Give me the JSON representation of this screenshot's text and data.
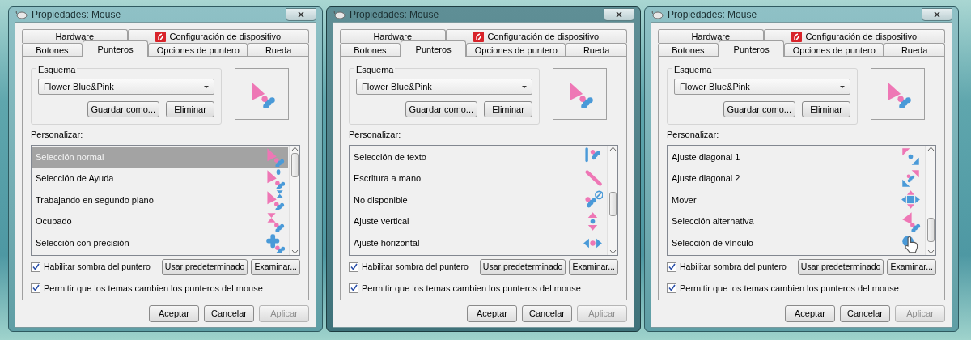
{
  "windows": [
    {
      "title": "Propiedades: Mouse",
      "active": false,
      "tabs_row1": [
        {
          "label": "Hardware",
          "selected": false
        },
        {
          "label": "Configuración de dispositivo",
          "selected": false
        }
      ],
      "tabs_row2": [
        {
          "label": "Botones",
          "selected": false
        },
        {
          "label": "Punteros",
          "selected": true
        },
        {
          "label": "Opciones de puntero",
          "selected": false
        },
        {
          "label": "Rueda",
          "selected": false
        }
      ],
      "scheme": {
        "legend": "Esquema",
        "value": "Flower Blue&Pink",
        "buttons": [
          "Guardar como...",
          "Eliminar"
        ]
      },
      "customize_label": "Personalizar:",
      "pointers": [
        {
          "label": "Selección normal",
          "kind": "normal",
          "selected": true
        },
        {
          "label": "Selección de Ayuda",
          "kind": "help",
          "selected": false
        },
        {
          "label": "Trabajando en segundo plano",
          "kind": "working",
          "selected": false
        },
        {
          "label": "Ocupado",
          "kind": "busy",
          "selected": false
        },
        {
          "label": "Selección con precisión",
          "kind": "precision",
          "selected": false
        }
      ],
      "checkboxes": [
        {
          "label": "Habilitar sombra del puntero",
          "checked": true
        },
        {
          "label": "Permitir que los temas cambien los punteros del mouse",
          "checked": true
        }
      ],
      "list_buttons": [
        "Usar predeterminado",
        "Examinar..."
      ],
      "footer_buttons": [
        {
          "label": "Aceptar",
          "disabled": false
        },
        {
          "label": "Cancelar",
          "disabled": false
        },
        {
          "label": "Aplicar",
          "disabled": true
        }
      ]
    },
    {
      "title": "Propiedades: Mouse",
      "active": true,
      "tabs_row1": [
        {
          "label": "Hardware",
          "selected": false
        },
        {
          "label": "Configuración de dispositivo",
          "selected": false
        }
      ],
      "tabs_row2": [
        {
          "label": "Botones",
          "selected": false
        },
        {
          "label": "Punteros",
          "selected": true
        },
        {
          "label": "Opciones de puntero",
          "selected": false
        },
        {
          "label": "Rueda",
          "selected": false
        }
      ],
      "scheme": {
        "legend": "Esquema",
        "value": "Flower Blue&Pink",
        "buttons": [
          "Guardar como...",
          "Eliminar"
        ]
      },
      "customize_label": "Personalizar:",
      "pointers": [
        {
          "label": "Selección de texto",
          "kind": "text",
          "selected": false
        },
        {
          "label": "Escritura a mano",
          "kind": "handwriting",
          "selected": false
        },
        {
          "label": "No disponible",
          "kind": "unavailable",
          "selected": false
        },
        {
          "label": "Ajuste vertical",
          "kind": "vertical",
          "selected": false
        },
        {
          "label": "Ajuste horizontal",
          "kind": "horizontal",
          "selected": false
        }
      ],
      "checkboxes": [
        {
          "label": "Habilitar sombra del puntero",
          "checked": true
        },
        {
          "label": "Permitir que los temas cambien los punteros del mouse",
          "checked": true
        }
      ],
      "list_buttons": [
        "Usar predeterminado",
        "Examinar..."
      ],
      "footer_buttons": [
        {
          "label": "Aceptar",
          "disabled": false
        },
        {
          "label": "Cancelar",
          "disabled": false
        },
        {
          "label": "Aplicar",
          "disabled": true
        }
      ]
    },
    {
      "title": "Propiedades: Mouse",
      "active": false,
      "tabs_row1": [
        {
          "label": "Hardware",
          "selected": false
        },
        {
          "label": "Configuración de dispositivo",
          "selected": false
        }
      ],
      "tabs_row2": [
        {
          "label": "Botones",
          "selected": false
        },
        {
          "label": "Punteros",
          "selected": true
        },
        {
          "label": "Opciones de puntero",
          "selected": false
        },
        {
          "label": "Rueda",
          "selected": false
        }
      ],
      "scheme": {
        "legend": "Esquema",
        "value": "Flower Blue&Pink",
        "buttons": [
          "Guardar como...",
          "Eliminar"
        ]
      },
      "customize_label": "Personalizar:",
      "pointers": [
        {
          "label": "Ajuste diagonal 1",
          "kind": "diag1",
          "selected": false
        },
        {
          "label": "Ajuste diagonal 2",
          "kind": "diag2",
          "selected": false
        },
        {
          "label": "Mover",
          "kind": "move",
          "selected": false
        },
        {
          "label": "Selección alternativa",
          "kind": "alternate",
          "selected": false
        },
        {
          "label": "Selección de vínculo",
          "kind": "link",
          "selected": false
        }
      ],
      "checkboxes": [
        {
          "label": "Habilitar sombra del puntero",
          "checked": true
        },
        {
          "label": "Permitir que los temas cambien los punteros del mouse",
          "checked": true
        }
      ],
      "list_buttons": [
        "Usar predeterminado",
        "Examinar..."
      ],
      "footer_buttons": [
        {
          "label": "Aceptar",
          "disabled": false
        },
        {
          "label": "Cancelar",
          "disabled": false
        },
        {
          "label": "Aplicar",
          "disabled": true
        }
      ]
    }
  ]
}
